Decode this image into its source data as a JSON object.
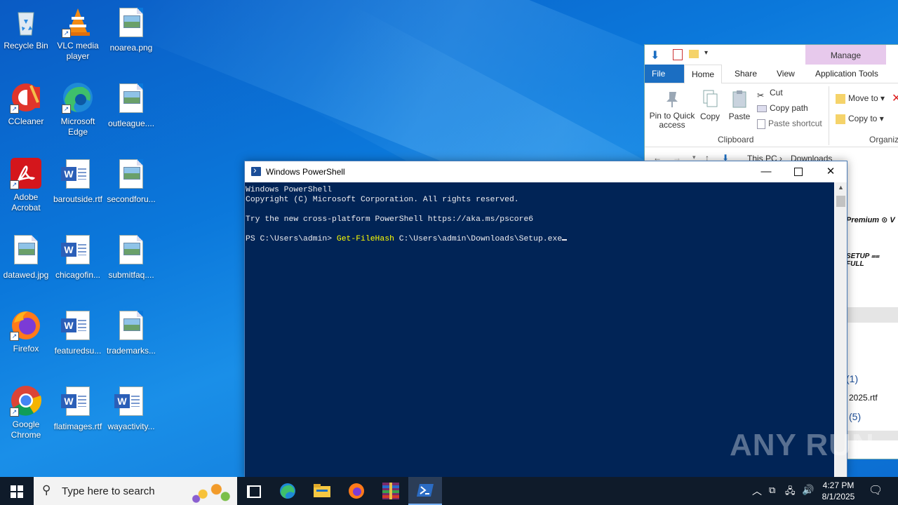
{
  "desktop": {
    "icons": [
      {
        "label": "Recycle Bin"
      },
      {
        "label": "VLC media player"
      },
      {
        "label": "noarea.png"
      },
      {
        "label": "CCleaner"
      },
      {
        "label": "Microsoft Edge"
      },
      {
        "label": "outleague...."
      },
      {
        "label": "Adobe Acrobat"
      },
      {
        "label": "baroutside.rtf"
      },
      {
        "label": "secondforu..."
      },
      {
        "label": "datawed.jpg"
      },
      {
        "label": "chicagofin..."
      },
      {
        "label": "submitfaq...."
      },
      {
        "label": "Firefox"
      },
      {
        "label": "featuredsu..."
      },
      {
        "label": "trademarks..."
      },
      {
        "label": "Google Chrome"
      },
      {
        "label": "flatimages.rtf"
      },
      {
        "label": "wayactivity..."
      }
    ],
    "watermark": "ANY RUN"
  },
  "explorer": {
    "context_tab": "Manage",
    "tabs": [
      "File",
      "Home",
      "Share",
      "View",
      "Application Tools"
    ],
    "ribbon": {
      "pin_label": "Pin to Quick access",
      "copy_label": "Copy",
      "paste_label": "Paste",
      "cut_label": "Cut",
      "copy_path_label": "Copy path",
      "paste_shortcut_label": "Paste shortcut",
      "move_to_label": "Move to",
      "copy_to_label": "Copy to",
      "clipboard_group": "Clipboard",
      "organize_group": "Organiz"
    },
    "address": {
      "crumb1": "This PC",
      "crumb2": "Downloads"
    },
    "content": {
      "line1": "Premium ⊙ V",
      "line2": "SETUP ⩵ FULL",
      "item1": "(1)",
      "item2": "2025.rtf",
      "item3": "(5)"
    }
  },
  "powershell": {
    "title": "Windows PowerShell",
    "lines": [
      "Windows PowerShell",
      "Copyright (C) Microsoft Corporation. All rights reserved.",
      "",
      "Try the new cross-platform PowerShell https://aka.ms/pscore6",
      ""
    ],
    "prompt": "PS C:\\Users\\admin> ",
    "command": "Get-FileHash",
    "argument": " C:\\Users\\admin\\Downloads\\Setup.exe"
  },
  "taskbar": {
    "search_placeholder": "Type here to search",
    "time": "4:27 PM",
    "date": "8/1/2025"
  }
}
